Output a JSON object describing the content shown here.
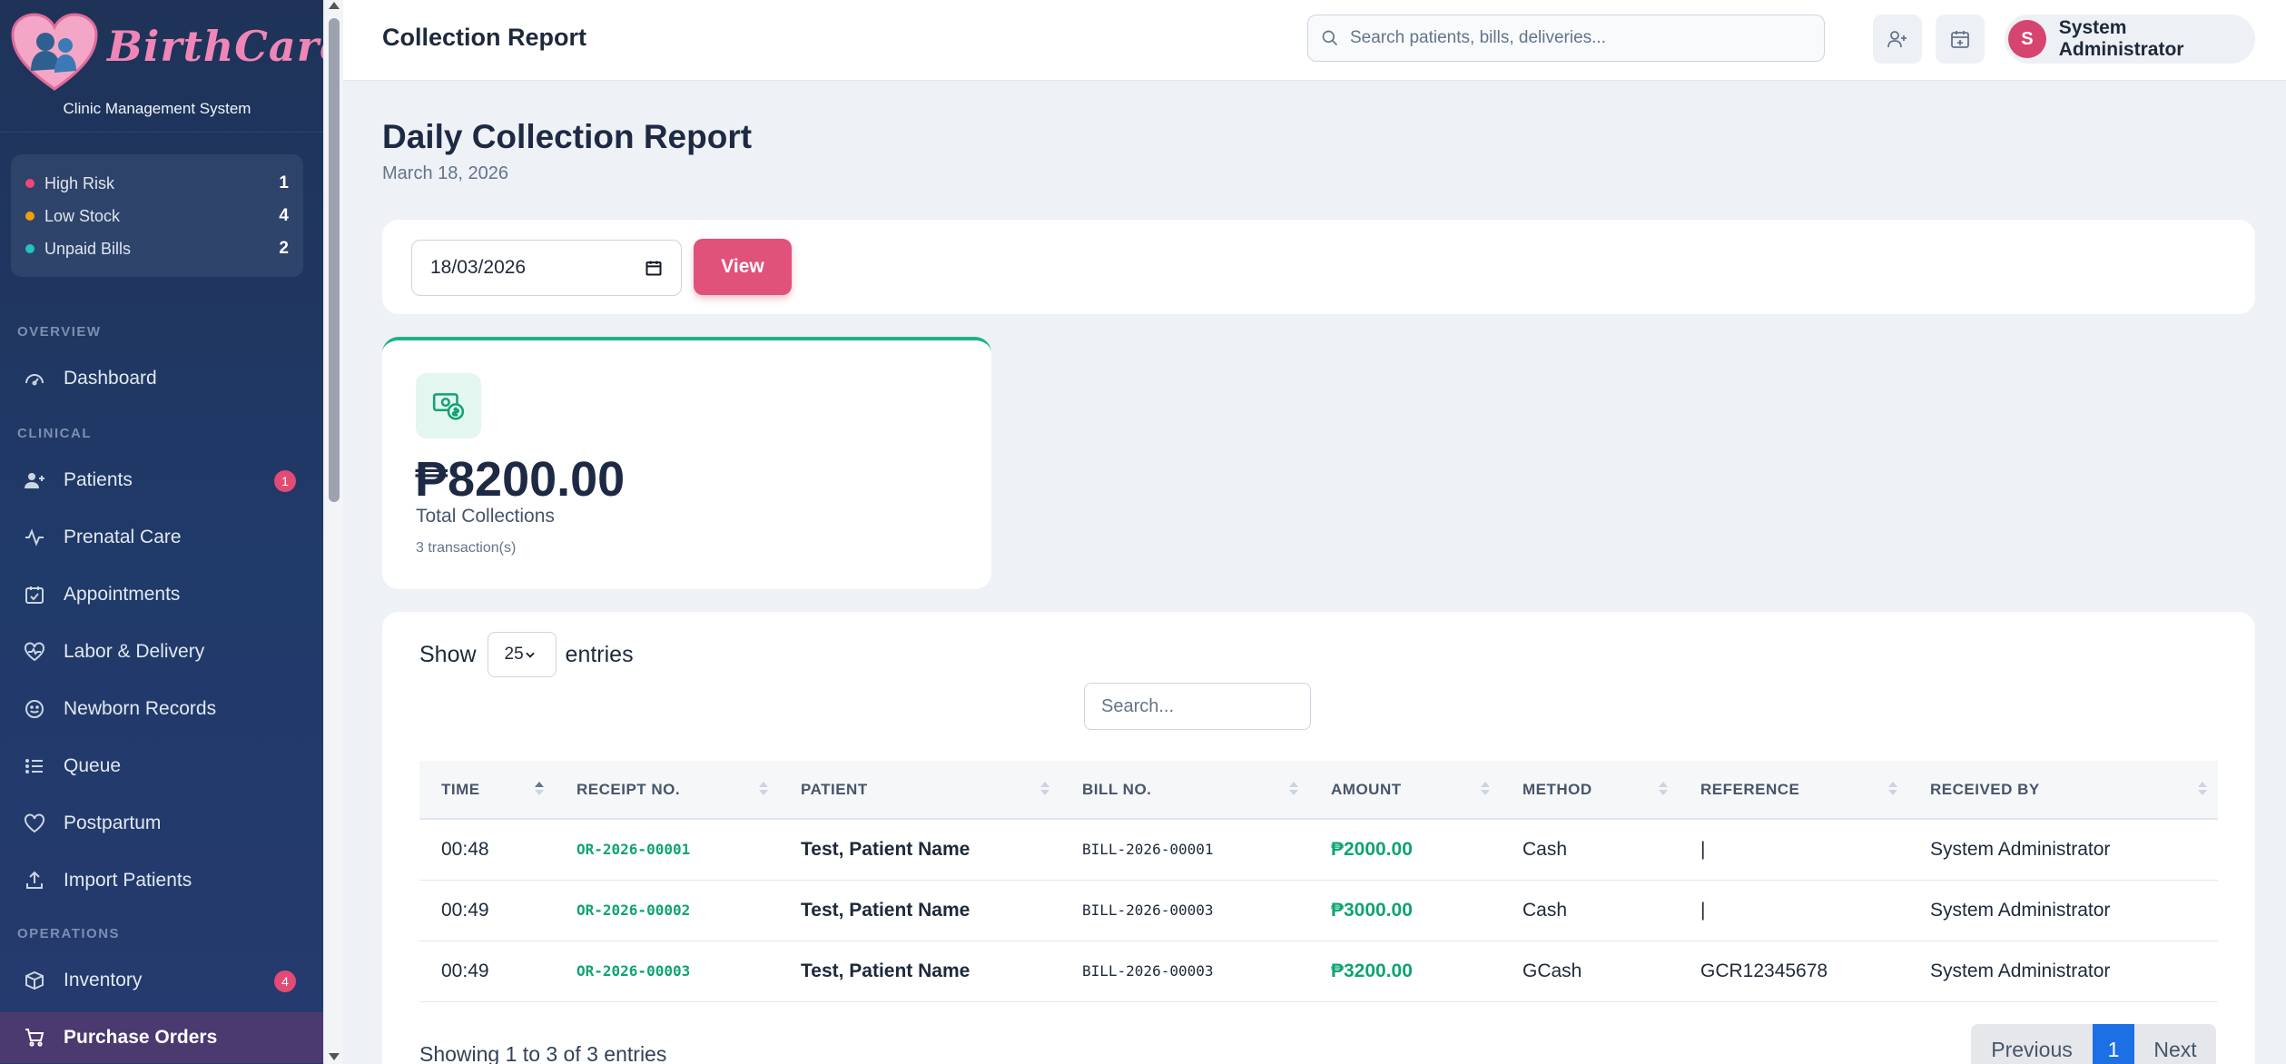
{
  "brand": {
    "name": "BirthCare",
    "subtitle": "Clinic Management System"
  },
  "alerts": [
    {
      "label": "High Risk",
      "count": "1",
      "color": "#f0457a"
    },
    {
      "label": "Low Stock",
      "count": "4",
      "color": "#f59e0b"
    },
    {
      "label": "Unpaid Bills",
      "count": "2",
      "color": "#22c3c0"
    }
  ],
  "nav": {
    "sections": {
      "overview": "OVERVIEW",
      "clinical": "CLINICAL",
      "operations": "OPERATIONS"
    },
    "items": [
      {
        "label": "Dashboard",
        "icon": "dashboard-icon"
      },
      {
        "label": "Patients",
        "icon": "user-group-icon",
        "badge": "1"
      },
      {
        "label": "Prenatal Care",
        "icon": "pulse-icon"
      },
      {
        "label": "Appointments",
        "icon": "calendar-check-icon"
      },
      {
        "label": "Labor & Delivery",
        "icon": "heart-pulse-icon"
      },
      {
        "label": "Newborn Records",
        "icon": "smile-icon"
      },
      {
        "label": "Queue",
        "icon": "list-icon"
      },
      {
        "label": "Postpartum",
        "icon": "heart-icon"
      },
      {
        "label": "Import Patients",
        "icon": "upload-icon"
      },
      {
        "label": "Inventory",
        "icon": "box-icon",
        "badge": "4"
      },
      {
        "label": "Purchase Orders",
        "icon": "cart-icon"
      }
    ]
  },
  "topbar": {
    "title": "Collection Report",
    "search_placeholder": "Search patients, bills, deliveries...",
    "user_initial": "S",
    "user_name": "System Administrator"
  },
  "page": {
    "heading": "Daily Collection Report",
    "date": "March 18, 2026"
  },
  "filter": {
    "date_value": "18/03/2026",
    "view_label": "View"
  },
  "summary": {
    "total": "₱8200.00",
    "label": "Total Collections",
    "sub": "3 transaction(s)"
  },
  "table": {
    "show_label": "Show",
    "entries_value": "25",
    "entries_label": "entries",
    "search_placeholder": "Search...",
    "columns": [
      "TIME",
      "RECEIPT NO.",
      "PATIENT",
      "BILL NO.",
      "AMOUNT",
      "METHOD",
      "REFERENCE",
      "RECEIVED BY"
    ],
    "rows": [
      {
        "time": "00:48",
        "receipt": "OR-2026-00001",
        "patient": "Test, Patient Name",
        "bill": "BILL-2026-00001",
        "amount": "₱2000.00",
        "method": "Cash",
        "reference": "|",
        "received_by": "System Administrator"
      },
      {
        "time": "00:49",
        "receipt": "OR-2026-00002",
        "patient": "Test, Patient Name",
        "bill": "BILL-2026-00003",
        "amount": "₱3000.00",
        "method": "Cash",
        "reference": "|",
        "received_by": "System Administrator"
      },
      {
        "time": "00:49",
        "receipt": "OR-2026-00003",
        "patient": "Test, Patient Name",
        "bill": "BILL-2026-00003",
        "amount": "₱3200.00",
        "method": "GCash",
        "reference": "GCR12345678",
        "received_by": "System Administrator"
      }
    ],
    "info": "Showing 1 to 3 of 3 entries",
    "pager": {
      "prev": "Previous",
      "current": "1",
      "next": "Next"
    }
  },
  "colors": {
    "accent": "#e0527a",
    "success": "#10a374",
    "sidebar": "#1f3358",
    "page_link": "#1d6fe6"
  }
}
